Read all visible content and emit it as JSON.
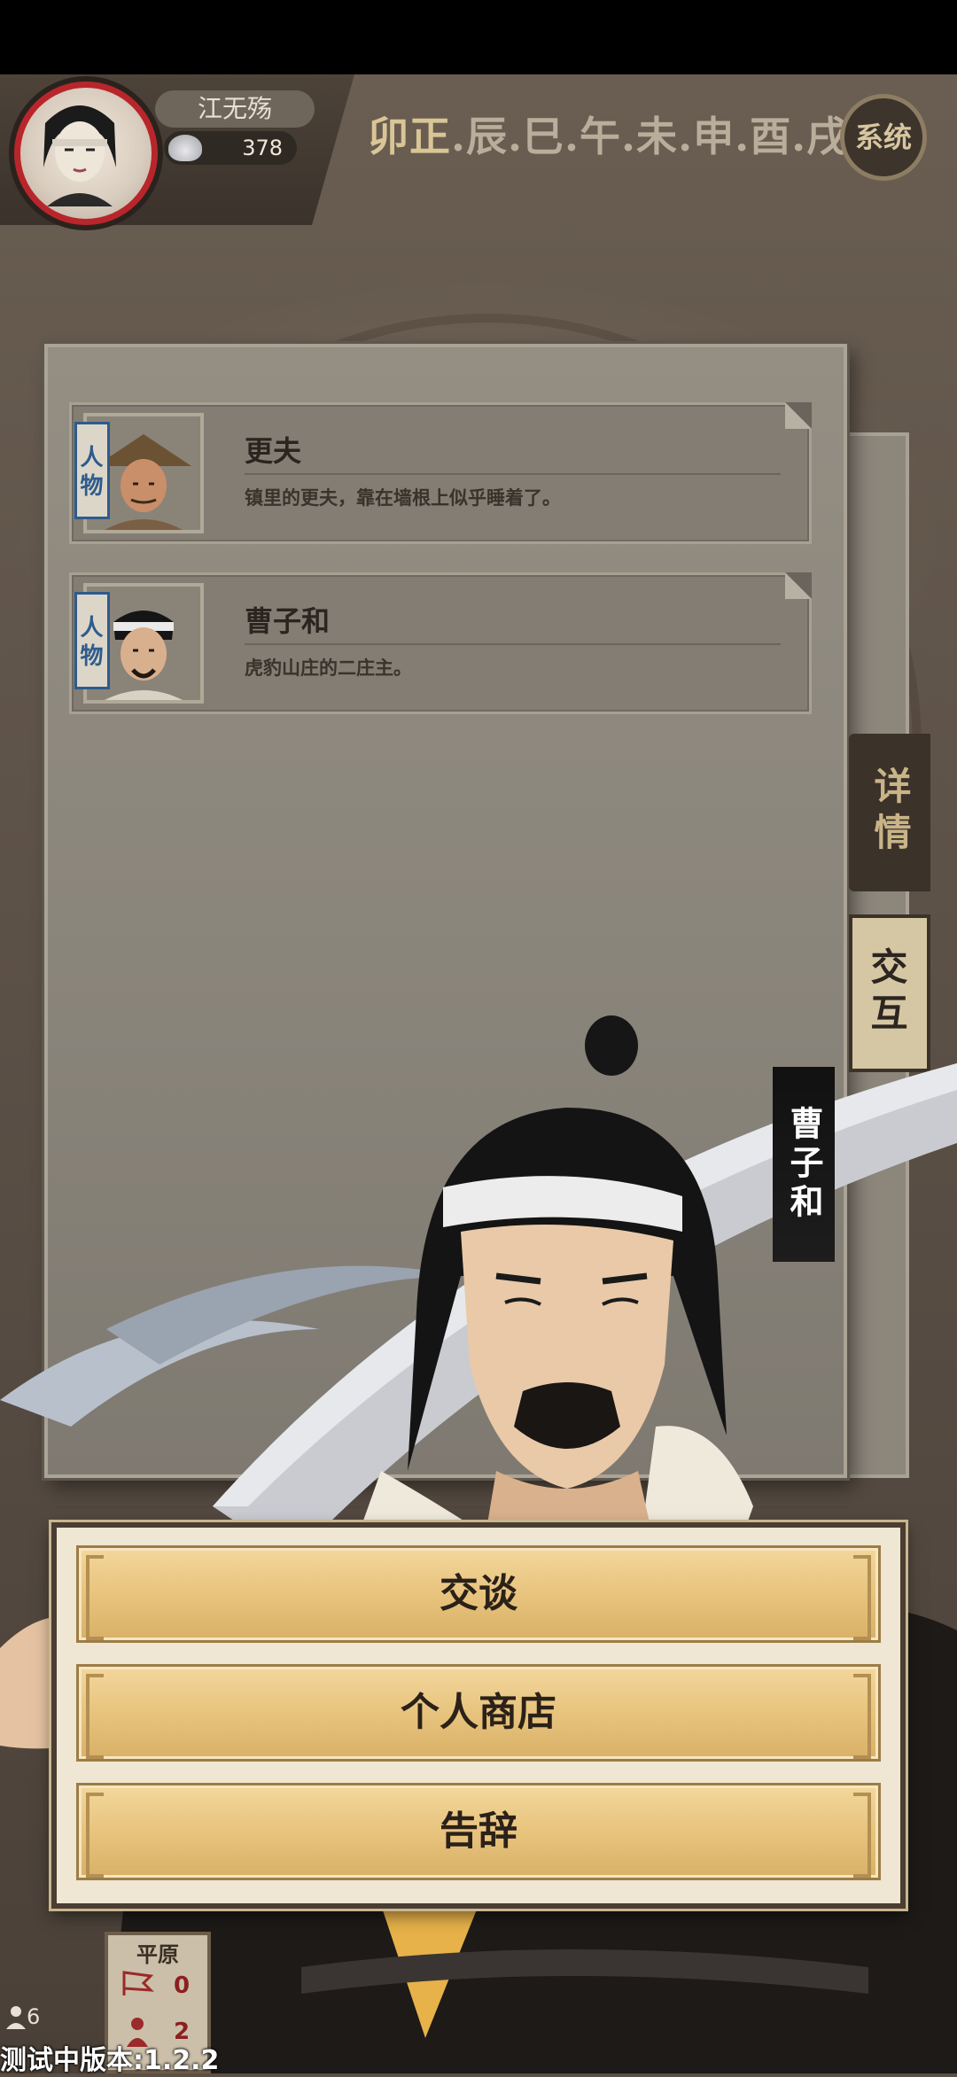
{
  "hud": {
    "player_name": "江无殇",
    "silver": "378",
    "time_segments": [
      "卯正",
      ".辰",
      ".巳",
      ".午",
      ".未",
      ".申",
      ".酉",
      ".戌"
    ],
    "system_label": "系统"
  },
  "npc_list": [
    {
      "tag": "人物",
      "name": "更夫",
      "desc": "镇里的更夫，靠在墙根上似乎睡着了。"
    },
    {
      "tag": "人物",
      "name": "曹子和",
      "desc": "虎豹山庄的二庄主。"
    }
  ],
  "side_tabs": {
    "detail": "详情",
    "interact": "交互"
  },
  "character_banner": "曹子和",
  "actions": [
    "交谈",
    "个人商店",
    "告辞"
  ],
  "mini_map": {
    "name": "平原",
    "count_a": "0",
    "count_b": "2"
  },
  "people_count": "6",
  "version": "测试中版本:1.2.2",
  "colors": {
    "accent_red": "#b8262b",
    "button_gold": "#e6c27b",
    "tab_dark": "#3b322a"
  }
}
